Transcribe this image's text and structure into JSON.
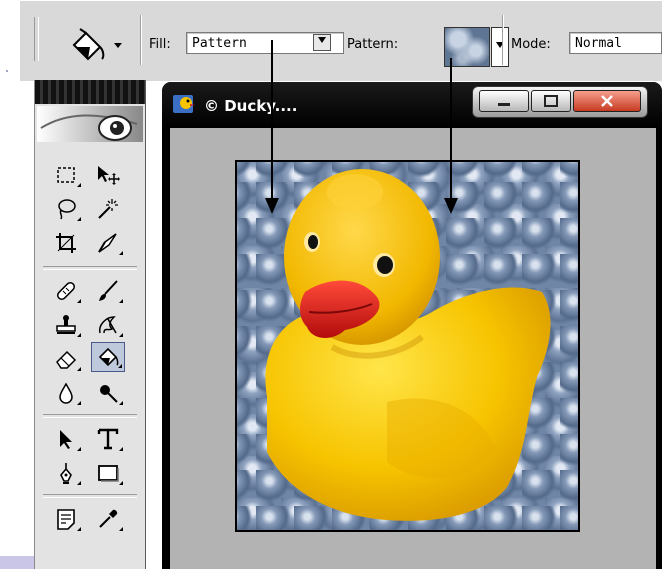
{
  "options_bar": {
    "fill_label": "Fill:",
    "fill_value": "Pattern",
    "pattern_label": "Pattern:",
    "mode_label": "Mode:",
    "mode_value": "Normal"
  },
  "document": {
    "title": "© Ducky...."
  },
  "colors": {
    "toolbar_bg": "#d9d9d9",
    "toolbox_bg": "#e3e3e3",
    "canvas_bg": "#b3b3b3",
    "window_frame": "#000000",
    "close_button": "#d8482e",
    "duck_yellow": "#f7c400",
    "beak_red": "#e31d1d",
    "pattern_blue": "#6f86a6"
  },
  "toolbox": {
    "tools": [
      "rectangular-marquee-icon",
      "move-icon",
      "lasso-icon",
      "magic-wand-icon",
      "crop-icon",
      "slice-icon",
      "healing-brush-icon",
      "brush-icon",
      "clone-stamp-icon",
      "history-brush-icon",
      "eraser-icon",
      "paint-bucket-icon",
      "blur-icon",
      "dodge-icon",
      "path-selection-icon",
      "type-icon",
      "pen-icon",
      "rectangle-shape-icon",
      "notes-icon",
      "eyedropper-icon"
    ],
    "active_tool": "paint-bucket-icon"
  }
}
